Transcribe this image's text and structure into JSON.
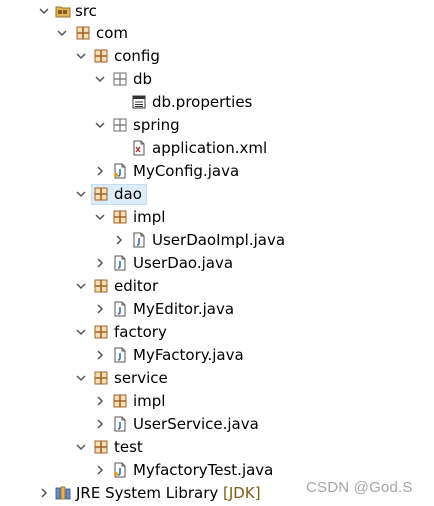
{
  "tree": {
    "src": "src",
    "com": "com",
    "config": "config",
    "db": "db",
    "db_properties": "db.properties",
    "spring": "spring",
    "application_xml": "application.xml",
    "myconfig": "MyConfig.java",
    "dao": "dao",
    "dao_impl": "impl",
    "userdaoimpl": "UserDaoImpl.java",
    "userdao": "UserDao.java",
    "editor": "editor",
    "myeditor": "MyEditor.java",
    "factory": "factory",
    "myfactory": "MyFactory.java",
    "service": "service",
    "service_impl": "impl",
    "userservice": "UserService.java",
    "test": "test",
    "myfactorytest": "MyfactoryTest.java",
    "jre_label": "JRE System Library",
    "jre_tag": "[JDK]"
  },
  "watermark": "CSDN @God.S",
  "colors": {
    "selection": "#dcecf8",
    "package_icon": "#b5651d",
    "java_icon": "#3c6eb4",
    "folder_icon": "#d8a03c"
  }
}
